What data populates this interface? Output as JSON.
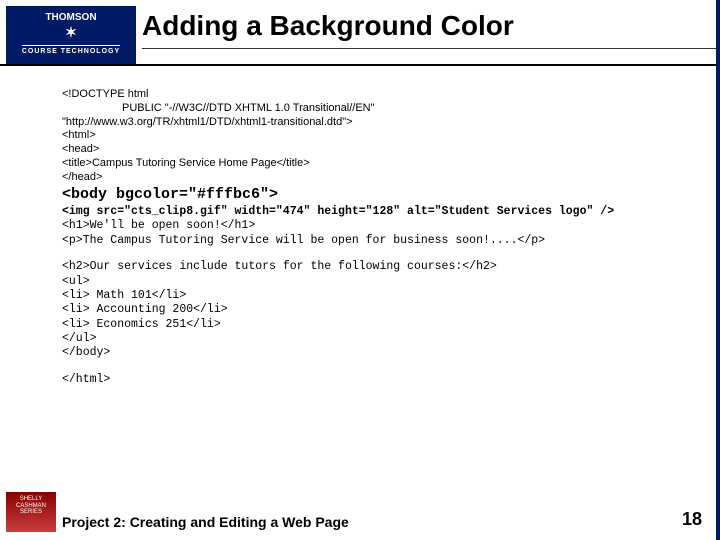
{
  "logo": {
    "brand": "THOMSON",
    "star": "✶",
    "sub": "COURSE TECHNOLOGY"
  },
  "title": "Adding a Background Color",
  "code": {
    "l1": "<!DOCTYPE html",
    "l2": "PUBLIC \"-//W3C//DTD XHTML 1.0 Transitional//EN\"",
    "l3": "\"http://www.w3.org/TR/xhtml1/DTD/xhtml1-transitional.dtd\">",
    "l4": "<html>",
    "l5": "<head>",
    "l6": "<title>Campus Tutoring Service Home Page</title>",
    "l7": "</head>",
    "body": "<body bgcolor=\"#fffbc6\">",
    "img": "<img src=\"cts_clip8.gif\" width=\"474\" height=\"128\" alt=\"Student Services logo\" />",
    "h1": "<h1>We'll be open soon!</h1>",
    "p1": "<p>The Campus Tutoring Service will be open for business soon!....</p>",
    "h2": "<h2>Our services include tutors for the following courses:</h2>",
    "ul_open": "<ul>",
    "li1": "<li> Math 101</li>",
    "li2": "<li> Accounting 200</li>",
    "li3": "<li> Economics 251</li>",
    "ul_close": "</ul>",
    "body_close": "</body>",
    "html_close": "</html>"
  },
  "footer": {
    "project": "Project 2: Creating and Editing a Web Page",
    "page": "18",
    "series": "SHELLY CASHMAN SERIES"
  }
}
